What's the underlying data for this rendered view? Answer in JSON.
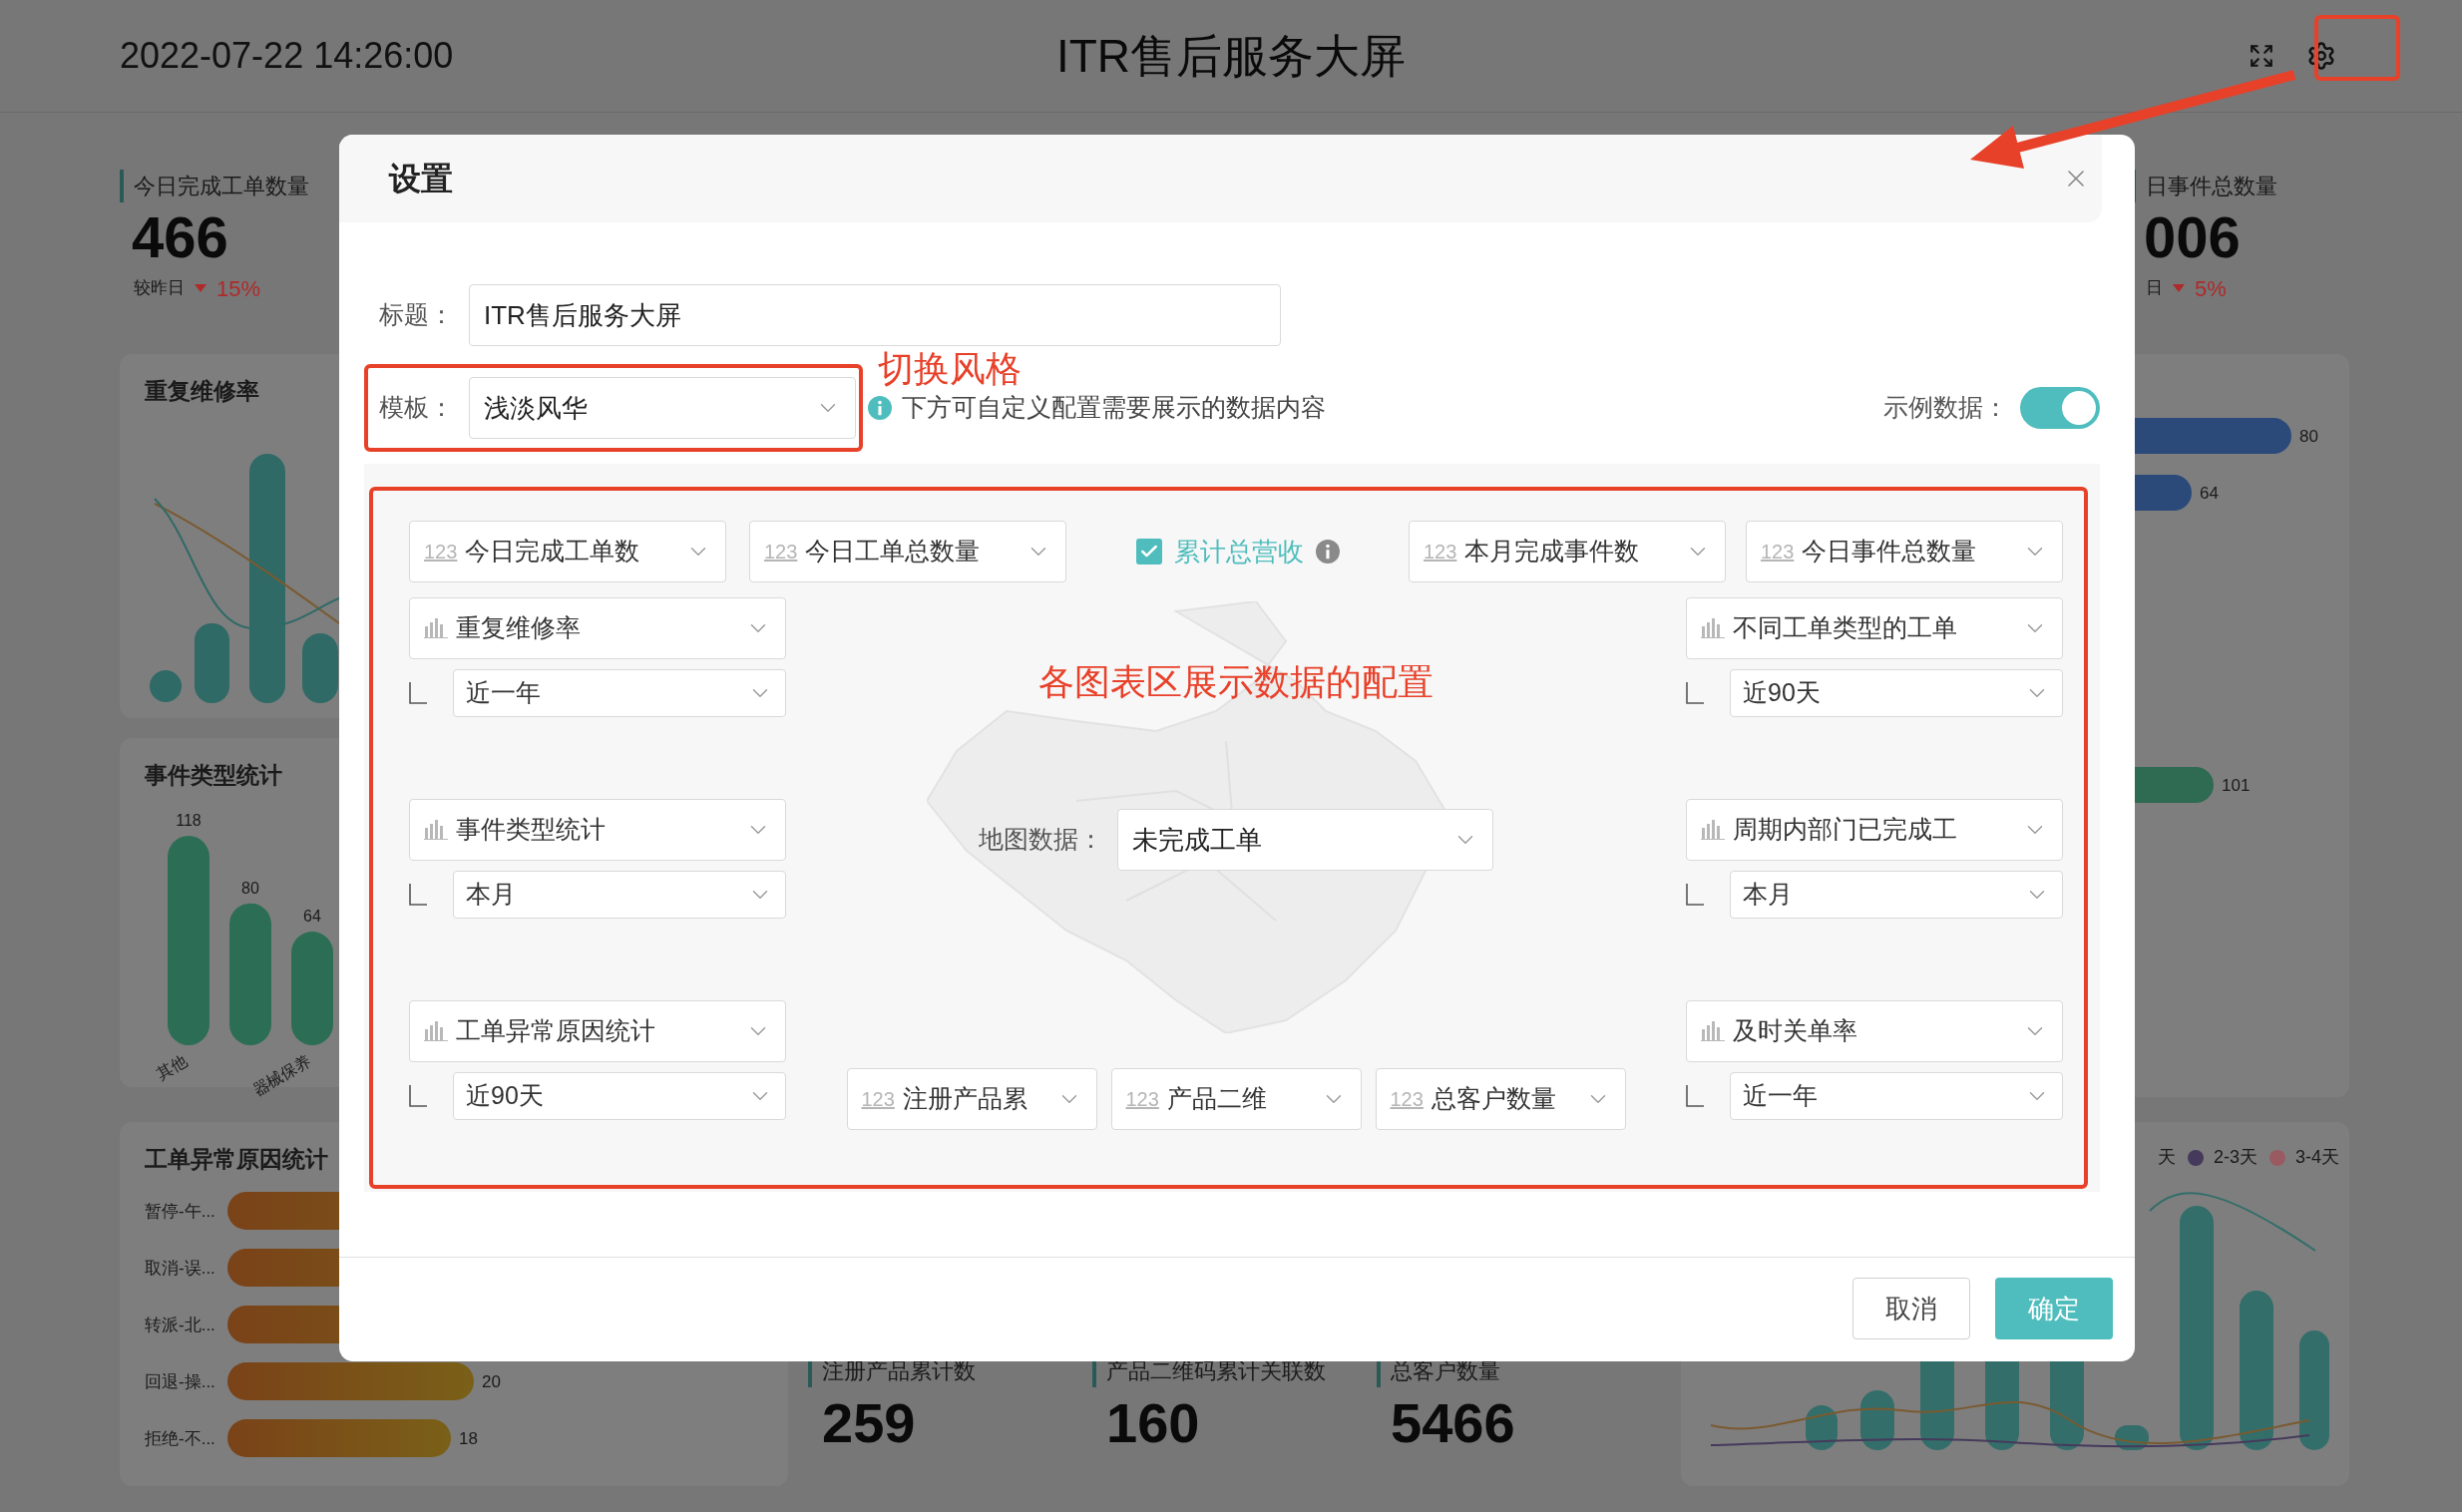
{
  "header": {
    "datetime": "2022-07-22 14:26:00",
    "title": "ITR售后服务大屏"
  },
  "dashboard": {
    "kpis": [
      {
        "label": "今日完成工单数量",
        "value": "466",
        "compare_label": "较昨日",
        "down": true,
        "change": "15%"
      },
      {
        "label": "日事件总数量",
        "value": "006",
        "compare_label": "日",
        "down": true,
        "change": "5%"
      }
    ],
    "repeat_card": {
      "title": "重复维修率"
    },
    "event_card": {
      "title": "事件类型统计",
      "chart_data": {
        "type": "bar",
        "categories": [
          "其他",
          null,
          "器械保养"
        ],
        "values": [
          118,
          80,
          64
        ],
        "data_labels": true
      }
    },
    "abnormal_card": {
      "title": "工单异常原因统计",
      "rows": [
        {
          "label": "暂停-午..."
        },
        {
          "label": "取消-误..."
        },
        {
          "label": "转派-北..."
        },
        {
          "label": "回退-操...",
          "value": "20"
        },
        {
          "label": "拒绝-不...",
          "value": "18"
        }
      ]
    },
    "right_values": [
      "80",
      "64"
    ],
    "green_values": [
      "101"
    ],
    "legend": [
      {
        "label": "天"
      },
      {
        "label": "2-3天",
        "color": "#463a5c"
      },
      {
        "label": "3-4天",
        "color": "#9a5a62"
      }
    ],
    "bottom_stats": [
      {
        "label": "注册产品累计数",
        "value": "259"
      },
      {
        "label": "产品二维码累计关联数",
        "value": "160"
      },
      {
        "label": "总客户数量",
        "value": "5466"
      }
    ]
  },
  "modal": {
    "title": "设置",
    "title_field": {
      "label": "标题：",
      "value": "ITR售后服务大屏"
    },
    "template_field": {
      "label": "模板：",
      "value": "浅淡风华"
    },
    "hint": "下方可自定义配置需要展示的数据内容",
    "sample_data": {
      "label": "示例数据：",
      "on": true
    },
    "top_row": [
      {
        "kind": "number",
        "badge": "123",
        "label": "今日完成工单数"
      },
      {
        "kind": "number",
        "badge": "123",
        "label": "今日工单总数量"
      },
      {
        "kind": "checkbox",
        "label": "累计总营收",
        "checked": true
      },
      {
        "kind": "number",
        "badge": "123",
        "label": "本月完成事件数"
      },
      {
        "kind": "number",
        "badge": "123",
        "label": "今日事件总数量"
      }
    ],
    "left_charts": [
      {
        "kind": "chart",
        "label": "重复维修率",
        "period": "近一年"
      },
      {
        "kind": "chart",
        "label": "事件类型统计",
        "period": "本月"
      },
      {
        "kind": "chart",
        "label": "工单异常原因统计",
        "period": "近90天"
      }
    ],
    "right_charts": [
      {
        "kind": "chart",
        "label": "不同工单类型的工单",
        "period": "近90天"
      },
      {
        "kind": "chart",
        "label": "周期内部门已完成工",
        "period": "本月"
      },
      {
        "kind": "chart",
        "label": "及时关单率",
        "period": "近一年"
      }
    ],
    "map": {
      "label": "地图数据：",
      "value": "未完成工单"
    },
    "bottom_row": [
      {
        "kind": "number",
        "badge": "123",
        "label": "注册产品累"
      },
      {
        "kind": "number",
        "badge": "123",
        "label": "产品二维"
      },
      {
        "kind": "number",
        "badge": "123",
        "label": "总客户数量"
      }
    ],
    "buttons": [
      {
        "kind": "default",
        "label": "取消"
      },
      {
        "kind": "primary",
        "label": "确定"
      }
    ]
  },
  "annotations": [
    {
      "text": "切换风格"
    },
    {
      "text": "各图表区展示数据的配置"
    }
  ]
}
